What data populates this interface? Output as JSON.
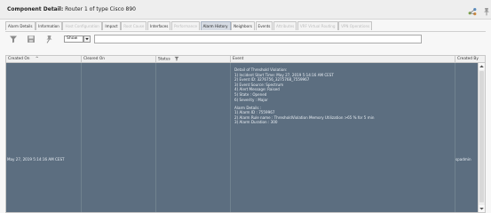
{
  "header": {
    "title_bold": "Component Detail:",
    "title_rest": " Router 1 of type Cisco 890"
  },
  "tabs": [
    {
      "label": "Alarm Details",
      "state": "normal"
    },
    {
      "label": "Information",
      "state": "normal"
    },
    {
      "label": "Host Configuration",
      "state": "disabled"
    },
    {
      "label": "Impact",
      "state": "normal"
    },
    {
      "label": "Root Cause",
      "state": "disabled"
    },
    {
      "label": "Interfaces",
      "state": "normal"
    },
    {
      "label": "Performance",
      "state": "disabled"
    },
    {
      "label": "Alarm History",
      "state": "active"
    },
    {
      "label": "Neighbors",
      "state": "normal"
    },
    {
      "label": "Events",
      "state": "normal"
    },
    {
      "label": "Attributes",
      "state": "disabled"
    },
    {
      "label": "VRF Virtual Routing",
      "state": "disabled"
    },
    {
      "label": "VPN Operations",
      "state": "disabled"
    }
  ],
  "toolbar": {
    "show_value": "Show",
    "search_placeholder": ""
  },
  "columns": {
    "created_on": "Created On",
    "cleared_on": "Cleared On",
    "status": "Status",
    "event": "Event",
    "created_by": "Created By"
  },
  "row": {
    "created_on": "May 27, 2019 5:14:16 AM CEST",
    "cleared_on": "",
    "status": "",
    "created_by": "spadmin",
    "event_lines": [
      "Detail of Threshold Violation:",
      "1) Incident Start Time: May 27, 2019 5:14:16 AM CEST",
      "2) Event ID: 3276756_3275768_7559967",
      "3) Event Source: Spectrum",
      "4) Alert Message: Raised",
      "5) State : Opened",
      "6) Severity : Major",
      "",
      "Alarm Details :",
      "1) Alarm ID : 7559967",
      "2) Alarm Rule name : ThresholdViolation Memory Utilization >65 % for 5 min",
      "3) Alarm Duration : 300"
    ]
  },
  "colors": {
    "row_background": "#5c6e80",
    "active_tab": "#d6dbe3"
  },
  "icons": {
    "header": [
      "network-share-icon",
      "pin-icon"
    ],
    "toolbar": [
      "filter-icon",
      "save-icon",
      "pin-icon"
    ],
    "created_on_sort": "sort-ascending-icon",
    "status_filter": "filter-icon"
  }
}
